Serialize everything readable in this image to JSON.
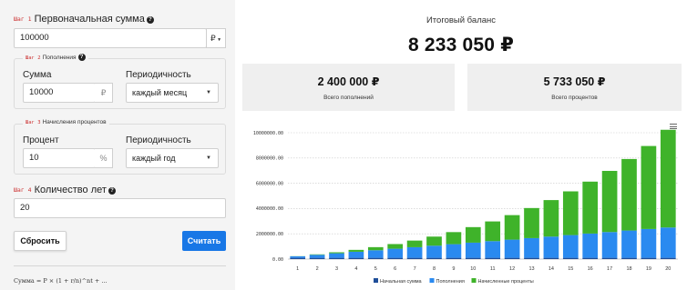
{
  "step1": {
    "step": "Шаг 1",
    "title": "Первоначальная сумма",
    "value": "100000",
    "currency": "₽"
  },
  "step2": {
    "step": "Шаг 2",
    "legend": "Пополнения",
    "amount_label": "Сумма",
    "amount_value": "10000",
    "amount_currency": "₽",
    "period_label": "Периодичность",
    "period_value": "каждый месяц"
  },
  "step3": {
    "step": "Шаг 3",
    "legend": "Начисления процентов",
    "rate_label": "Процент",
    "rate_value": "10",
    "rate_unit": "%",
    "period_label": "Периодичность",
    "period_value": "каждый год"
  },
  "step4": {
    "step": "Шаг 4",
    "title": "Количество лет",
    "value": "20"
  },
  "buttons": {
    "reset": "Сбросить",
    "calc": "Считать"
  },
  "formula": "Сумма = P × (1 + r/n)^nt + ...",
  "summary": {
    "total_label": "Итоговый баланс",
    "total_value": "8 233 050 ₽",
    "deposits_value": "2 400 000 ₽",
    "deposits_label": "Всего пополнений",
    "interest_value": "5 733 050 ₽",
    "interest_label": "Всего процентов"
  },
  "chart_data": {
    "type": "bar",
    "stacked": true,
    "categories": [
      "1",
      "2",
      "3",
      "4",
      "5",
      "6",
      "7",
      "8",
      "9",
      "10",
      "11",
      "12",
      "13",
      "14",
      "15",
      "16",
      "17",
      "18",
      "19",
      "20"
    ],
    "series": [
      {
        "name": "Начальная сумма",
        "color": "#1f4e99",
        "values": [
          100000,
          100000,
          100000,
          100000,
          100000,
          100000,
          100000,
          100000,
          100000,
          100000,
          100000,
          100000,
          100000,
          100000,
          100000,
          100000,
          100000,
          100000,
          100000,
          100000
        ]
      },
      {
        "name": "Пополнения",
        "color": "#2a8af0",
        "values": [
          120000,
          240000,
          360000,
          480000,
          600000,
          720000,
          840000,
          960000,
          1080000,
          1200000,
          1320000,
          1440000,
          1560000,
          1680000,
          1800000,
          1920000,
          2040000,
          2160000,
          2280000,
          2400000
        ]
      },
      {
        "name": "Начисленные проценты",
        "color": "#3fb32a",
        "values": [
          10000,
          35000,
          80000,
          150000,
          245000,
          370000,
          525000,
          720000,
          955000,
          1230000,
          1560000,
          1940000,
          2380000,
          2890000,
          3460000,
          4110000,
          4840000,
          5660000,
          6570000,
          7733050
        ]
      }
    ],
    "y_ticks": [
      "10000000.00",
      "8000000.00",
      "6000000.00",
      "4000000.00",
      "2000000.00",
      "0.00"
    ],
    "ylim": [
      0,
      10000000
    ],
    "grid": true,
    "legend_position": "bottom"
  }
}
